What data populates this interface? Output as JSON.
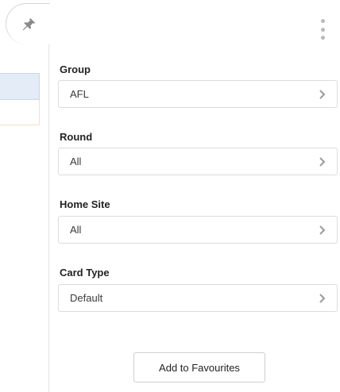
{
  "filters": [
    {
      "label": "Group",
      "value": "AFL"
    },
    {
      "label": "Round",
      "value": "All"
    },
    {
      "label": "Home Site",
      "value": "All"
    },
    {
      "label": "Card Type",
      "value": "Default"
    }
  ],
  "actions": {
    "add_favourites_label": "Add to Favourites"
  },
  "icons": {
    "pin": "pin-icon",
    "menu": "more-vertical-icon",
    "chevron": "chevron-right-icon"
  },
  "colors": {
    "border": "#dcdcdc",
    "chevron": "#9a9a9a",
    "highlight": "#e3ecf7"
  }
}
